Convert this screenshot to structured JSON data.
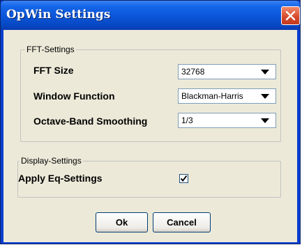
{
  "window": {
    "title": "OpWin Settings"
  },
  "fft": {
    "legend": "FFT-Settings",
    "size_label": "FFT Size",
    "size_value": "32768",
    "window_label": "Window Function",
    "window_value": "Blackman-Harris",
    "smoothing_label": "Octave-Band Smoothing",
    "smoothing_value": "1/3"
  },
  "display": {
    "legend": "Display-Settings",
    "eq_label": "Apply Eq-Settings",
    "eq_checked": true
  },
  "buttons": {
    "ok": "Ok",
    "cancel": "Cancel"
  },
  "colors": {
    "titlebar": "#0a55d8",
    "client": "#ece9d8",
    "close": "#d6482a"
  }
}
